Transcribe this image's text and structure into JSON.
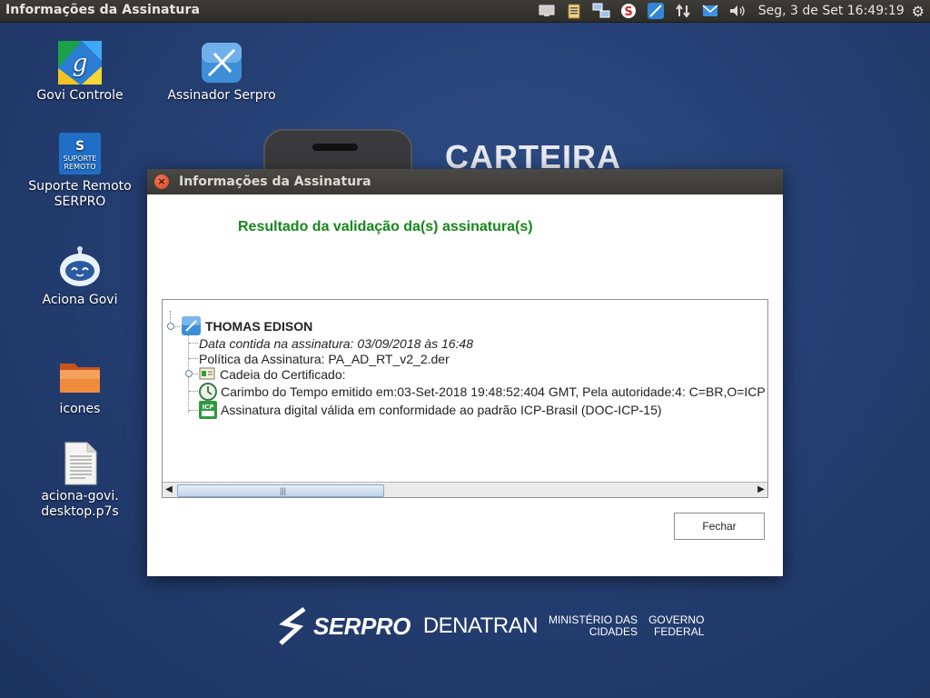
{
  "top_panel": {
    "window_title": "Informações da Assinatura",
    "clock": "Seg,  3 de Set 16:49:19"
  },
  "desktop_icons": [
    {
      "label": "Govi Controle",
      "icon": "govi-controle-icon"
    },
    {
      "label": "Assinador Serpro",
      "icon": "assinador-serpro-icon"
    },
    {
      "label": "Suporte Remoto SERPRO",
      "icon": "suporte-remoto-icon"
    },
    {
      "label": "Aciona Govi",
      "icon": "robot-icon"
    },
    {
      "label": "icones",
      "icon": "folder-icon"
    },
    {
      "label": "aciona-govi. desktop.p7s",
      "icon": "document-icon"
    }
  ],
  "wallpaper": {
    "carteira": "CARTEIRA",
    "serpro": "SERPRO",
    "denatran": "DENATRAN",
    "ministerio": "MINISTÉRIO DAS",
    "cidades": "CIDADES",
    "governo": "GOVERNO",
    "federal": "FEDERAL"
  },
  "dialog": {
    "title": "Informações da Assinatura",
    "heading": "Resultado da validação da(s) assinatura(s)",
    "tree": {
      "root": "THOMAS EDISON",
      "items": [
        "Data contida na assinatura: 03/09/2018 às 16:48",
        "Política da Assinatura: PA_AD_RT_v2_2.der",
        "Cadeia do Certificado:",
        "Carimbo do Tempo emitido em:03-Set-2018 19:48:52:404 GMT, Pela autoridade:4: C=BR,O=ICP",
        "Assinatura digital válida em conformidade ao padrão ICP-Brasil (DOC-ICP-15)"
      ]
    },
    "close_button": "Fechar"
  }
}
